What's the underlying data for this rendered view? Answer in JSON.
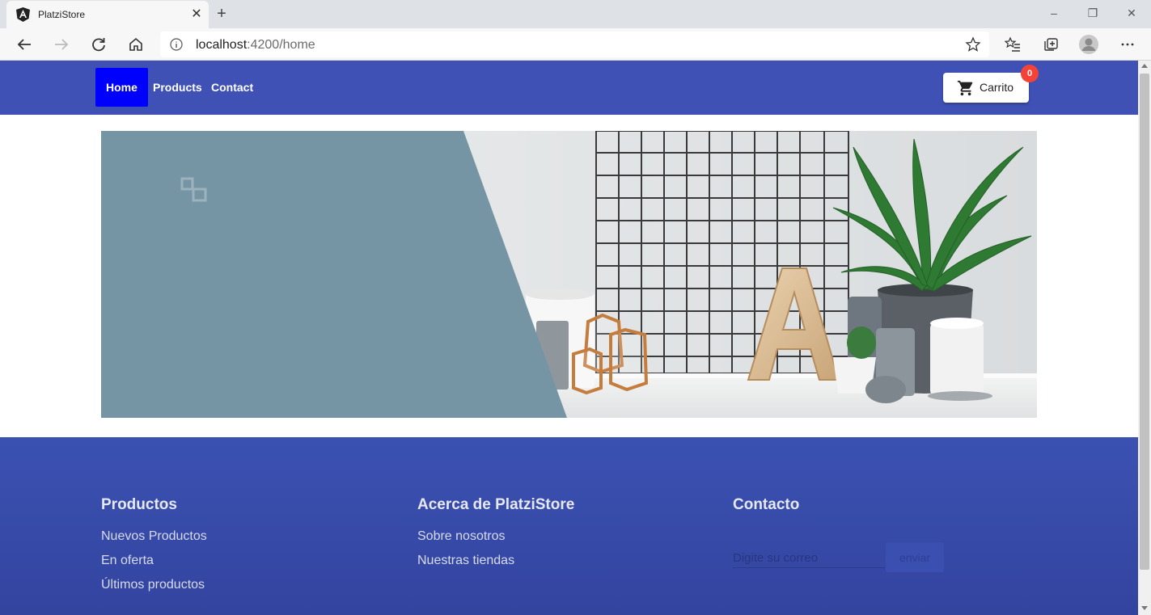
{
  "browser": {
    "tab_title": "PlatziStore",
    "url_host": "localhost",
    "url_path": ":4200/home"
  },
  "navbar": {
    "links": [
      {
        "label": "Home",
        "active": true
      },
      {
        "label": "Products",
        "active": false
      },
      {
        "label": "Contact",
        "active": false
      }
    ],
    "cart_label": "Carrito",
    "cart_count": "0",
    "color": "#3f51b5"
  },
  "footer": {
    "columns": [
      {
        "heading": "Productos",
        "links": [
          "Nuevos Productos",
          "En oferta",
          "Últimos productos"
        ]
      },
      {
        "heading": "Acerca de PlatziStore",
        "links": [
          "Sobre nosotros",
          "Nuestras tiendas"
        ]
      },
      {
        "heading": "Contacto"
      }
    ],
    "email_placeholder": "Digite su correo",
    "send_label": "enviar"
  }
}
